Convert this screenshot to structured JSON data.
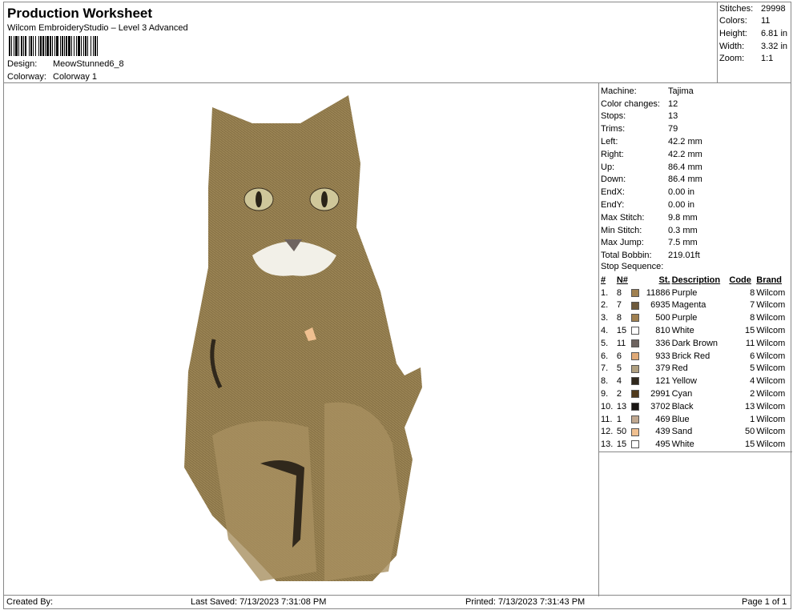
{
  "header": {
    "title": "Production Worksheet",
    "subtitle": "Wilcom EmbroideryStudio – Level 3 Advanced",
    "design_label": "Design:",
    "design": "MeowStunned6_8",
    "colorway_label": "Colorway:",
    "colorway": "Colorway 1"
  },
  "stats": [
    {
      "k": "Stitches:",
      "v": "29998"
    },
    {
      "k": "Colors:",
      "v": "11"
    },
    {
      "k": "Height:",
      "v": "6.81 in"
    },
    {
      "k": "Width:",
      "v": "3.32 in"
    },
    {
      "k": "Zoom:",
      "v": "1:1"
    }
  ],
  "info": [
    {
      "k": "Machine:",
      "v": "Tajima"
    },
    {
      "k": "Color changes:",
      "v": "12"
    },
    {
      "k": "Stops:",
      "v": "13"
    },
    {
      "k": "Trims:",
      "v": "79"
    },
    {
      "k": "Left:",
      "v": "42.2 mm"
    },
    {
      "k": "Right:",
      "v": "42.2 mm"
    },
    {
      "k": "Up:",
      "v": "86.4 mm"
    },
    {
      "k": "Down:",
      "v": "86.4 mm"
    },
    {
      "k": "EndX:",
      "v": "0.00 in"
    },
    {
      "k": "EndY:",
      "v": "0.00 in"
    },
    {
      "k": "Max Stitch:",
      "v": "9.8 mm"
    },
    {
      "k": "Min Stitch:",
      "v": "0.3 mm"
    },
    {
      "k": "Max Jump:",
      "v": "7.5 mm"
    },
    {
      "k": "Total Bobbin:",
      "v": "219.01ft"
    }
  ],
  "stop_sequence": {
    "title": "Stop Sequence:",
    "headers": [
      "#",
      "N#",
      "St.",
      "Description",
      "Code",
      "Brand"
    ],
    "rows": [
      [
        "1.",
        "8",
        "#a08050",
        "11886",
        "Purple",
        "8",
        "Wilcom"
      ],
      [
        "2.",
        "7",
        "#6e5a3c",
        "6935",
        "Magenta",
        "7",
        "Wilcom"
      ],
      [
        "3.",
        "8",
        "#a08050",
        "500",
        "Purple",
        "8",
        "Wilcom"
      ],
      [
        "4.",
        "15",
        "#ffffff",
        "810",
        "White",
        "15",
        "Wilcom"
      ],
      [
        "5.",
        "11",
        "#6e6460",
        "336",
        "Dark Brown",
        "11",
        "Wilcom"
      ],
      [
        "6.",
        "6",
        "#e0aa78",
        "933",
        "Brick Red",
        "6",
        "Wilcom"
      ],
      [
        "7.",
        "5",
        "#b0a080",
        "379",
        "Red",
        "5",
        "Wilcom"
      ],
      [
        "8.",
        "4",
        "#30281c",
        "121",
        "Yellow",
        "4",
        "Wilcom"
      ],
      [
        "9.",
        "2",
        "#503a1c",
        "2991",
        "Cyan",
        "2",
        "Wilcom"
      ],
      [
        "10.",
        "13",
        "#1a1614",
        "3702",
        "Black",
        "13",
        "Wilcom"
      ],
      [
        "11.",
        "1",
        "#c0a890",
        "469",
        "Blue",
        "1",
        "Wilcom"
      ],
      [
        "12.",
        "50",
        "#f0c090",
        "439",
        "Sand",
        "50",
        "Wilcom"
      ],
      [
        "13.",
        "15",
        "#ffffff",
        "495",
        "White",
        "15",
        "Wilcom"
      ]
    ]
  },
  "footer": {
    "created": "Created By:",
    "saved": "Last Saved: 7/13/2023 7:31:08 PM",
    "printed": "Printed: 7/13/2023 7:31:43 PM",
    "page": "Page 1 of 1"
  }
}
